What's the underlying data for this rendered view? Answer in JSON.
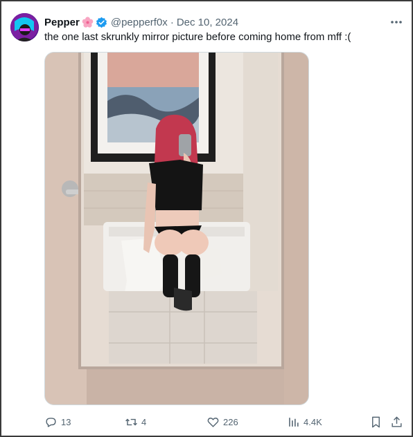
{
  "author": {
    "name": "Pepper",
    "handle": "@pepperf0x",
    "date": "Dec 10, 2024",
    "emoji_icon": "cherry-blossom-icon",
    "verified_icon": "verified-badge-icon"
  },
  "tweet": {
    "text": "the one last skrunkly mirror picture before coming home from mff :("
  },
  "media": {
    "icon": "mirror-selfie-photo"
  },
  "metrics": {
    "replies": "13",
    "reposts": "4",
    "likes": "226",
    "views": "4.4K"
  },
  "colors": {
    "text": "#0f1419",
    "secondary": "#536471",
    "verified": "#1d9bf0",
    "border": "#cfd9de"
  }
}
